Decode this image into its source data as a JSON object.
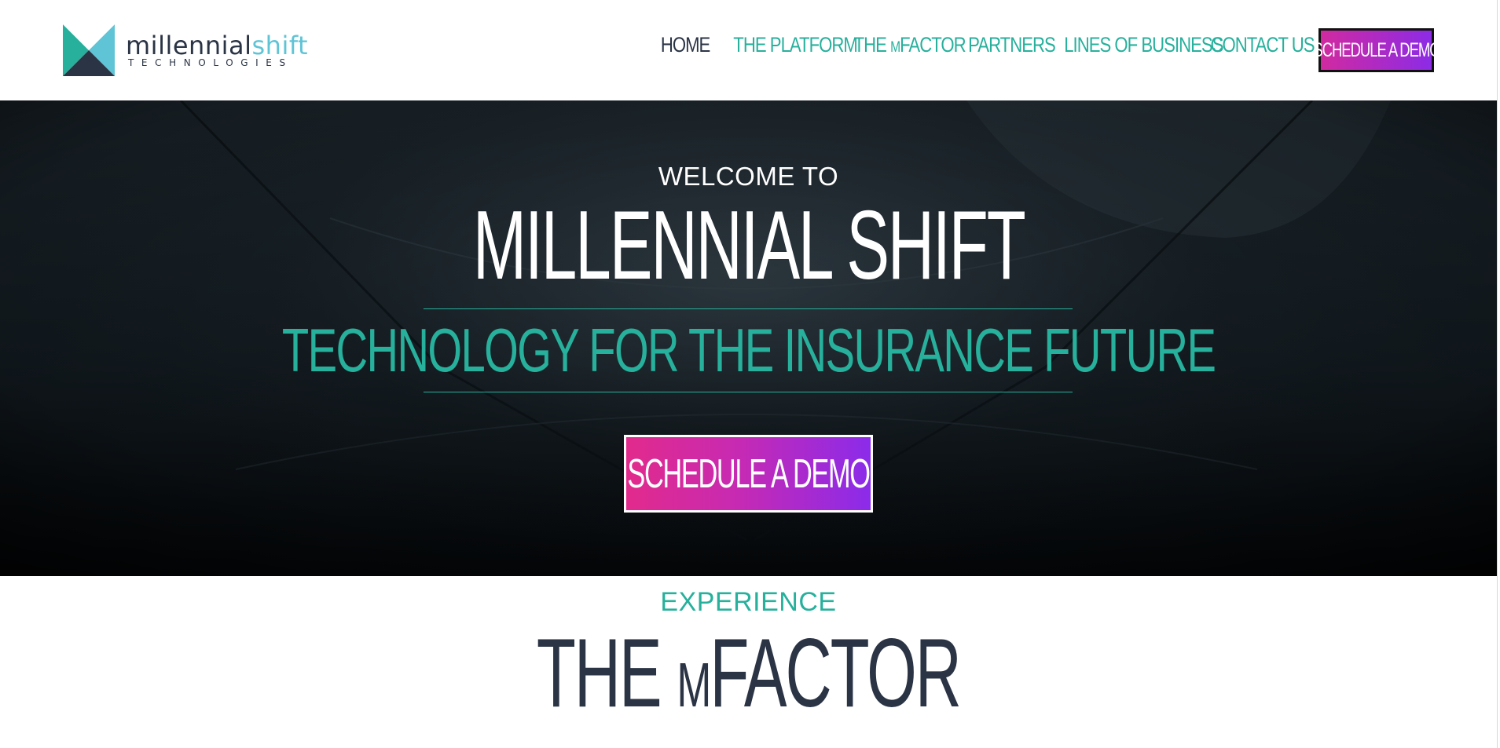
{
  "header": {
    "logo": {
      "word_part1": "millennial",
      "word_part2": "shift",
      "subtitle": "TECHNOLOGIES",
      "colors": {
        "dark": "#2b3445",
        "teal": "#27b09c",
        "light_blue": "#5fc4d6"
      }
    },
    "nav": {
      "items": [
        {
          "label": "HOME",
          "active": true
        },
        {
          "label": "THE PLATFORM",
          "active": false
        },
        {
          "label_prefix": "THE ",
          "label_small": "M",
          "label_suffix": "FACTOR",
          "active": false
        },
        {
          "label": "PARTNERS",
          "active": false
        },
        {
          "label": "LINES OF BUSINESS",
          "active": false
        },
        {
          "label": "CONTACT US",
          "active": false
        }
      ],
      "cta_label": "SCHEDULE A DEMO"
    }
  },
  "hero": {
    "welcome": "WELCOME TO",
    "title": "MILLENNIAL SHIFT",
    "tagline": "TECHNOLOGY FOR THE INSURANCE FUTURE",
    "cta_label": "SCHEDULE A DEMO"
  },
  "section": {
    "eyebrow": "EXPERIENCE",
    "title_prefix": "THE ",
    "title_small": "M",
    "title_suffix": "FACTOR"
  },
  "colors": {
    "accent_teal": "#27b09c",
    "text_dark": "#2b3445",
    "cta_gradient_start": "#e22a8c",
    "cta_gradient_end": "#8b2bea",
    "hero_bg": "#141d23"
  }
}
